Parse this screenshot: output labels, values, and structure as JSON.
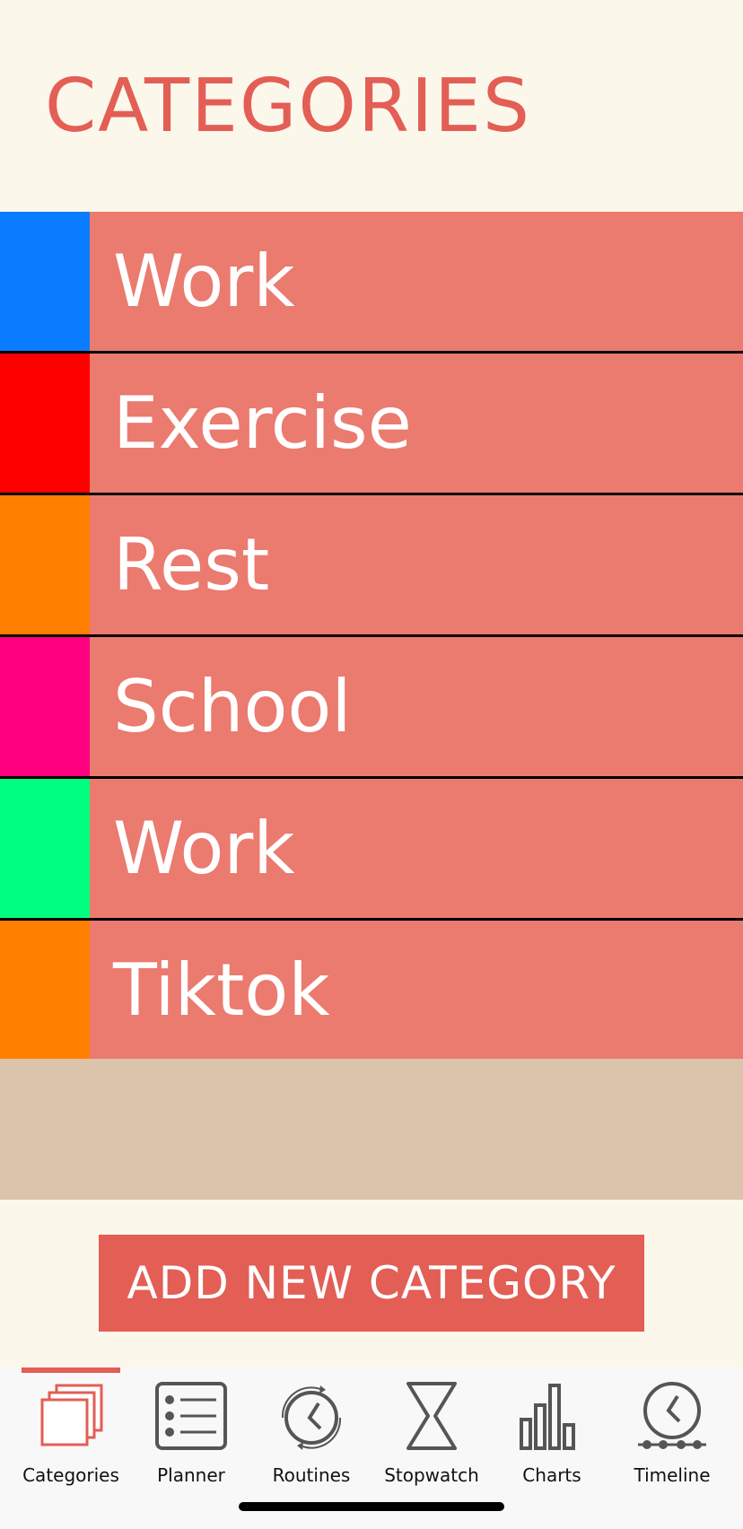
{
  "header": {
    "title": "CATEGORIES"
  },
  "categories": [
    {
      "label": "Work",
      "color": "#0a7cff"
    },
    {
      "label": "Exercise",
      "color": "#ff0000"
    },
    {
      "label": "Rest",
      "color": "#ff7f00"
    },
    {
      "label": "School",
      "color": "#ff0080"
    },
    {
      "label": "Work",
      "color": "#00ff80"
    },
    {
      "label": "Tiktok",
      "color": "#ff7f00"
    }
  ],
  "add_button": {
    "label": "ADD NEW CATEGORY"
  },
  "tabs": [
    {
      "label": "Categories",
      "icon": "categories-icon",
      "active": true
    },
    {
      "label": "Planner",
      "icon": "planner-icon",
      "active": false
    },
    {
      "label": "Routines",
      "icon": "routines-icon",
      "active": false
    },
    {
      "label": "Stopwatch",
      "icon": "hourglass-icon",
      "active": false
    },
    {
      "label": "Charts",
      "icon": "bar-chart-icon",
      "active": false
    },
    {
      "label": "Timeline",
      "icon": "timeline-icon",
      "active": false
    }
  ],
  "colors": {
    "accent": "#e35e55",
    "row_background": "#eb7a6f",
    "blank_row": "#dcc4ac",
    "page_background": "#fbf7ea"
  }
}
